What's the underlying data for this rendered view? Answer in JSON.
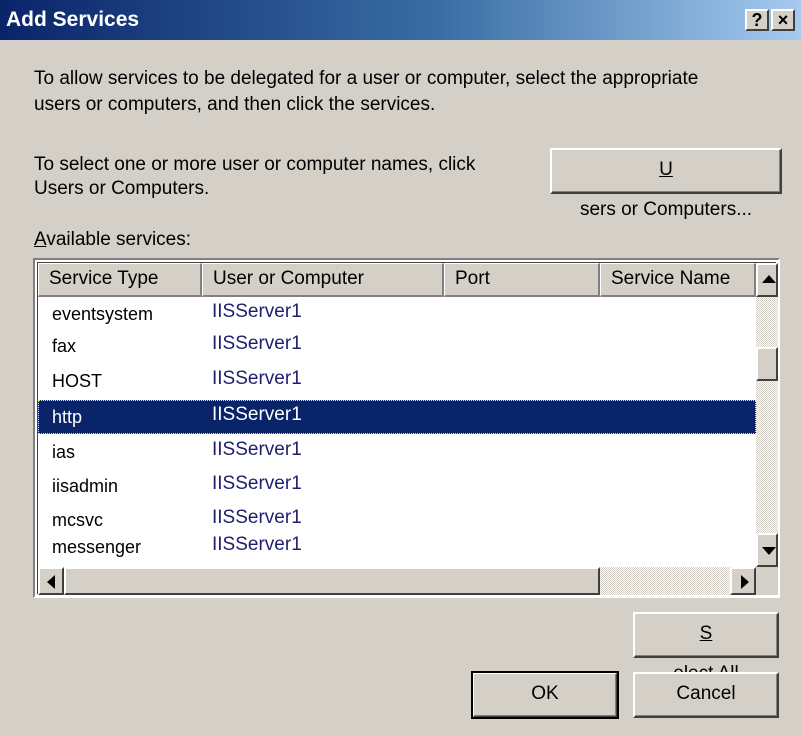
{
  "window": {
    "title": "Add Services",
    "help_glyph": "?",
    "close_glyph": "×"
  },
  "intro_line1": "To allow services to be delegated for a user or computer, select the appropriate",
  "intro_line2": "users or computers, and then click the services.",
  "select_line1": "To select one or more user or computer names, click",
  "select_line2": "Users or Computers.",
  "users_button": {
    "underlined": "U",
    "rest": "sers or Computers..."
  },
  "available_label": {
    "underlined": "A",
    "rest": "vailable services:"
  },
  "list": {
    "columns": [
      "Service Type",
      "User or Computer",
      "Port",
      "Service Name"
    ],
    "rows": [
      {
        "type": "eventsystem",
        "user": "IISServer1",
        "selected": false
      },
      {
        "type": "fax",
        "user": "IISServer1",
        "selected": false
      },
      {
        "type": "HOST",
        "user": "IISServer1",
        "selected": false
      },
      {
        "type": "http",
        "user": "IISServer1",
        "selected": true
      },
      {
        "type": "ias",
        "user": "IISServer1",
        "selected": false
      },
      {
        "type": "iisadmin",
        "user": "IISServer1",
        "selected": false
      },
      {
        "type": "mcsvc",
        "user": "IISServer1",
        "selected": false
      },
      {
        "type": "messenger",
        "user": "IISServer1",
        "selected": false
      }
    ]
  },
  "select_all_button": {
    "underlined": "S",
    "rest": "elect All"
  },
  "ok_button": "OK",
  "cancel_button": "Cancel",
  "colors": {
    "title_bar": "#0a246a",
    "selection": "#0a246a",
    "dialog_bg": "#d4d0c8"
  }
}
